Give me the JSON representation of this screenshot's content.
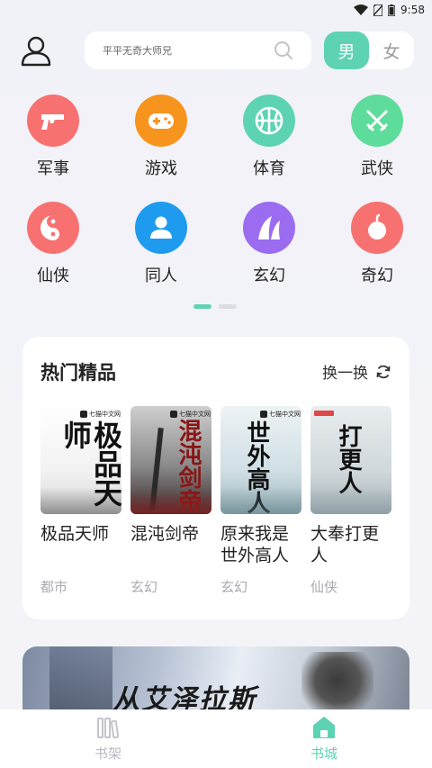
{
  "status_bar": {
    "time": "9:58"
  },
  "header": {
    "search_placeholder": "平平无奇大师兄",
    "gender_options": [
      "男",
      "女"
    ],
    "gender_selected": "男"
  },
  "categories": [
    {
      "label": "军事",
      "icon": "gun-icon",
      "color": "#f87171"
    },
    {
      "label": "游戏",
      "icon": "gamepad-icon",
      "color": "#f7941d"
    },
    {
      "label": "体育",
      "icon": "basketball-icon",
      "color": "#5ed3b4"
    },
    {
      "label": "武侠",
      "icon": "crossed-swords-icon",
      "color": "#5edc9c"
    },
    {
      "label": "仙侠",
      "icon": "yin-yang-icon",
      "color": "#f87171"
    },
    {
      "label": "同人",
      "icon": "person-icon",
      "color": "#1e9bef"
    },
    {
      "label": "玄幻",
      "icon": "mountain-icon",
      "color": "#9b6cf0"
    },
    {
      "label": "奇幻",
      "icon": "bomb-icon",
      "color": "#f87171"
    }
  ],
  "hot": {
    "title": "热门精品",
    "refresh_label": "换一换",
    "books": [
      {
        "name": "极品天师",
        "category": "都市",
        "cover_text": "极品天师",
        "publisher": "七猫中文网"
      },
      {
        "name": "混沌剑帝",
        "category": "玄幻",
        "cover_text": "混沌剑帝",
        "publisher": "七猫中文网"
      },
      {
        "name": "原来我是世外高人",
        "category": "玄幻",
        "cover_text": "世外高人",
        "publisher": "七猫中文网"
      },
      {
        "name": "大奉打更人",
        "category": "仙侠",
        "cover_text": "打更人",
        "publisher": ""
      }
    ]
  },
  "banner": {
    "text": "从艾泽拉斯"
  },
  "tabs": [
    {
      "label": "书架",
      "icon": "bookshelf-icon"
    },
    {
      "label": "书城",
      "icon": "home-icon"
    }
  ],
  "colors": {
    "accent": "#5ed3b4",
    "card_bg": "#ffffff",
    "page_bg": "#f2f2f7"
  }
}
